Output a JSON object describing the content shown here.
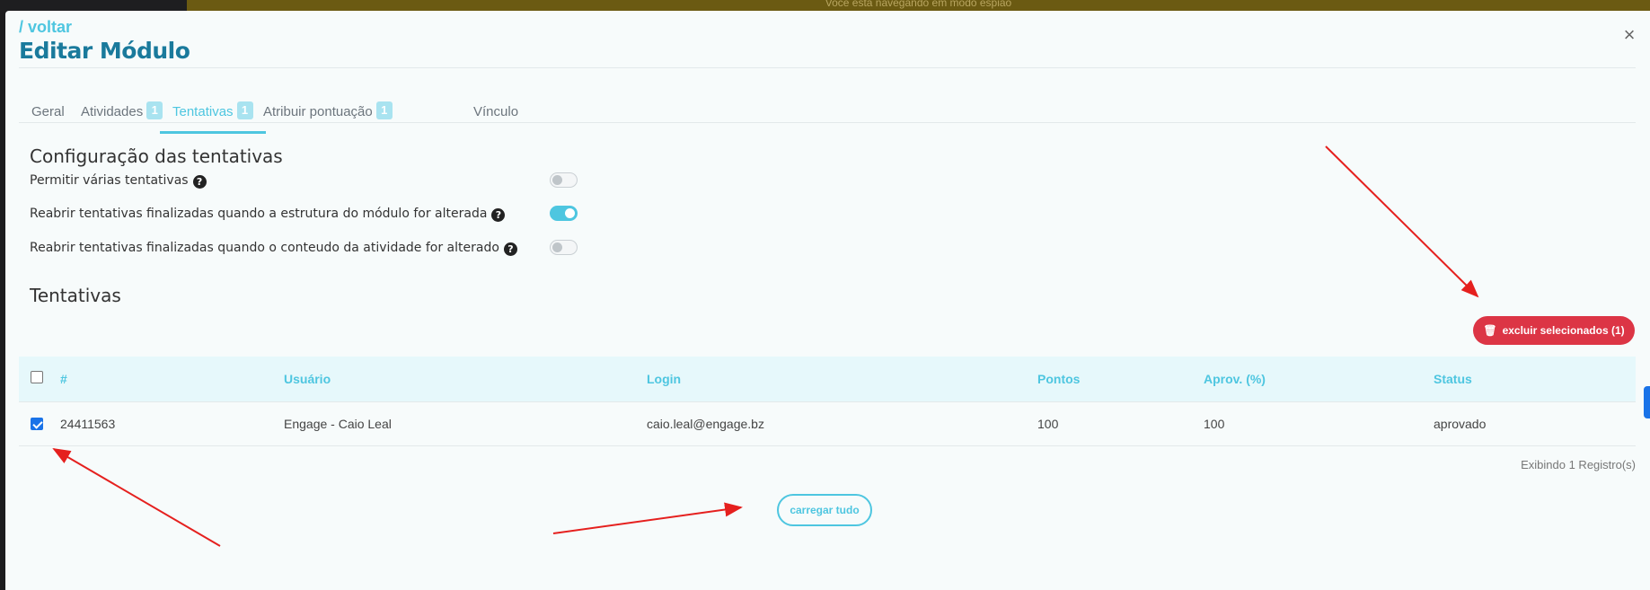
{
  "spy_banner": "Você está navegando em modo espião",
  "header": {
    "back_label": "/ voltar",
    "title": "Editar Módulo",
    "close_label": "×"
  },
  "tabs": [
    {
      "label": "Geral",
      "badge": ""
    },
    {
      "label": "Atividades",
      "badge": "1"
    },
    {
      "label": "Tentativas",
      "badge": "1",
      "active": true
    },
    {
      "label": "Atribuir pontuação",
      "badge": "1"
    },
    {
      "label": "Vínculo",
      "badge": ""
    }
  ],
  "config": {
    "title": "Configuração das tentativas",
    "settings": [
      {
        "label": "Permitir várias tentativas",
        "enabled": false
      },
      {
        "label": "Reabrir tentativas finalizadas quando a estrutura do módulo for alterada",
        "enabled": true
      },
      {
        "label": "Reabrir tentativas finalizadas quando o conteudo da atividade for alterado",
        "enabled": false
      }
    ]
  },
  "attempts": {
    "title": "Tentativas",
    "delete_button": "excluir selecionados (1)",
    "columns": [
      "#",
      "Usuário",
      "Login",
      "Pontos",
      "Aprov. (%)",
      "Status"
    ],
    "rows": [
      {
        "checked": true,
        "id": "24411563",
        "user": "Engage - Caio Leal",
        "login": "caio.leal@engage.bz",
        "points": "100",
        "approval": "100",
        "status": "aprovado"
      }
    ],
    "records_text": "Exibindo 1 Registro(s)",
    "load_all_button": "carregar tudo"
  },
  "colors": {
    "accent": "#4ec6e0",
    "title": "#1a7a9c",
    "danger": "#dc3545",
    "annotation_arrow": "#e5201e"
  }
}
